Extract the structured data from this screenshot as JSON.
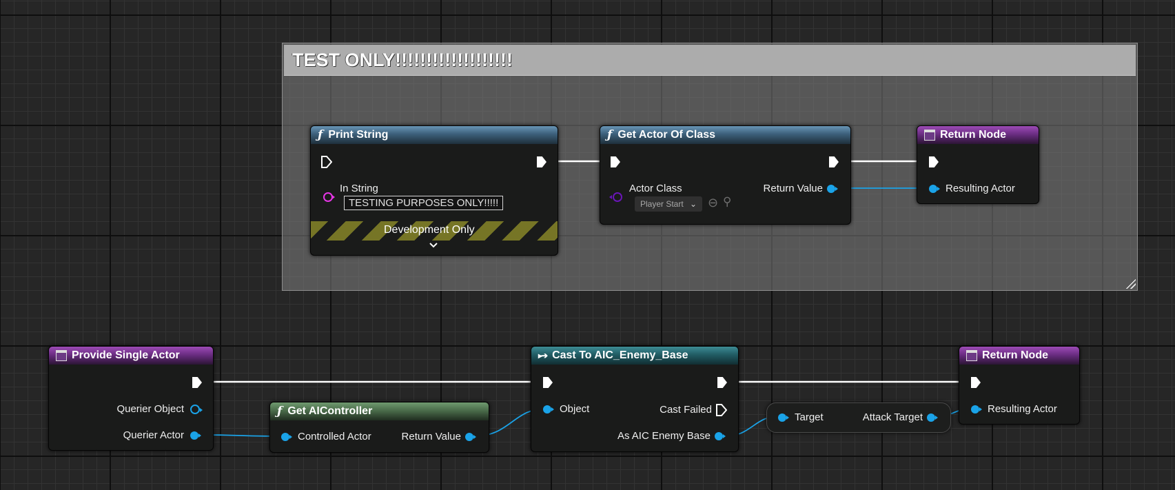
{
  "comment": {
    "title": "TEST ONLY!!!!!!!!!!!!!!!!!!!"
  },
  "print_string": {
    "title": "Print String",
    "in_string_label": "In String",
    "in_string_value": "TESTING PURPOSES ONLY!!!!!",
    "footer": "Development Only"
  },
  "get_actor_of_class": {
    "title": "Get Actor Of Class",
    "actor_class_label": "Actor Class",
    "actor_class_value": "Player Start",
    "return_value_label": "Return Value"
  },
  "return_node_top": {
    "title": "Return Node",
    "pin_label": "Resulting Actor"
  },
  "provide_single_actor": {
    "title": "Provide Single Actor",
    "querier_object_label": "Querier Object",
    "querier_actor_label": "Querier Actor"
  },
  "get_ai_controller": {
    "title": "Get AIController",
    "controlled_actor_label": "Controlled Actor",
    "return_value_label": "Return Value"
  },
  "cast_to": {
    "title": "Cast To AIC_Enemy_Base",
    "object_label": "Object",
    "cast_failed_label": "Cast Failed",
    "as_label": "As AIC Enemy Base"
  },
  "attack_target_node": {
    "target_label": "Target",
    "attack_target_label": "Attack Target"
  },
  "return_node_bottom": {
    "title": "Return Node",
    "pin_label": "Resulting Actor"
  },
  "colors": {
    "exec_wire": "#ffffff",
    "object_wire": "#1aa3e8",
    "string_pin": "#e636e6",
    "class_pin": "#6a16b8"
  }
}
